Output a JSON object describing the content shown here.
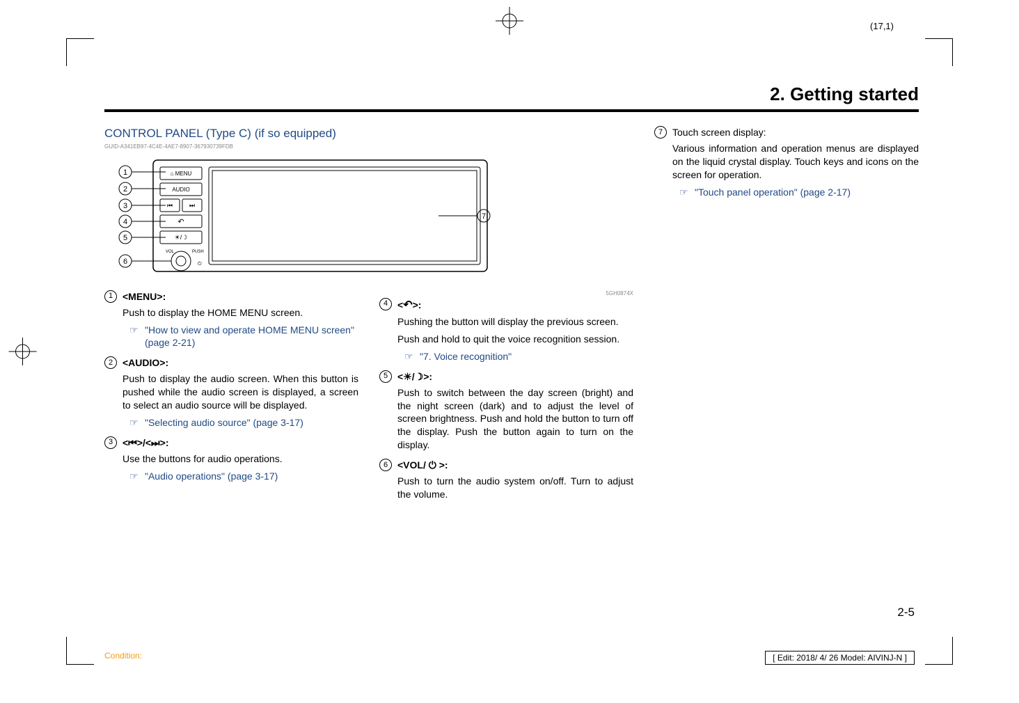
{
  "page_coord": "(17,1)",
  "chapter_title": "2. Getting started",
  "section_title": "CONTROL PANEL (Type C) (if so equipped)",
  "guid": "GUID-A341EB97-4C4E-4AE7-8907-367930739FDB",
  "img_code": "5GH0874X",
  "diagram_labels": {
    "b1": "MENU",
    "b2": "AUDIO"
  },
  "items": {
    "i1": {
      "label": "<MENU>:",
      "body": "Push to display the HOME MENU screen.",
      "ref": "\"How to view and operate HOME MENU screen\" (page 2-21)"
    },
    "i2": {
      "label": "<AUDIO>:",
      "body": "Push to display the audio screen. When this button is pushed while the audio screen is displayed, a screen to select an audio source will be displayed.",
      "ref": "\"Selecting audio source\" (page 3-17)"
    },
    "i3": {
      "label_prefix": "<",
      "label_mid": ">/<",
      "label_suffix": ">:",
      "body": "Use the buttons for audio operations.",
      "ref": "\"Audio operations\" (page 3-17)"
    },
    "i4": {
      "label_prefix": "<",
      "label_suffix": ">:",
      "body1": "Pushing the button will display the previous screen.",
      "body2": "Push and hold to quit the voice recognition session.",
      "ref": "\"7. Voice recognition\""
    },
    "i5": {
      "label_prefix": "<",
      "label_suffix": ">:",
      "body": "Push to switch between the day screen (bright) and the night screen (dark) and to adjust the level of screen brightness. Push and hold the button to turn off the display. Push the button again to turn on the display."
    },
    "i6": {
      "label_prefix": "<VOL/ ",
      "label_suffix": " >:",
      "body": "Push to turn the audio system on/off. Turn to adjust the volume."
    },
    "i7": {
      "label": "Touch screen display:",
      "body": "Various information and operation menus are displayed on the liquid crystal display. Touch keys and icons on the screen for operation.",
      "ref": "\"Touch panel operation\" (page 2-17)"
    }
  },
  "page_num": "2-5",
  "footer": {
    "condition": "Condition:",
    "edit": "[ Edit: 2018/ 4/ 26    Model: AIVINJ-N ]"
  }
}
